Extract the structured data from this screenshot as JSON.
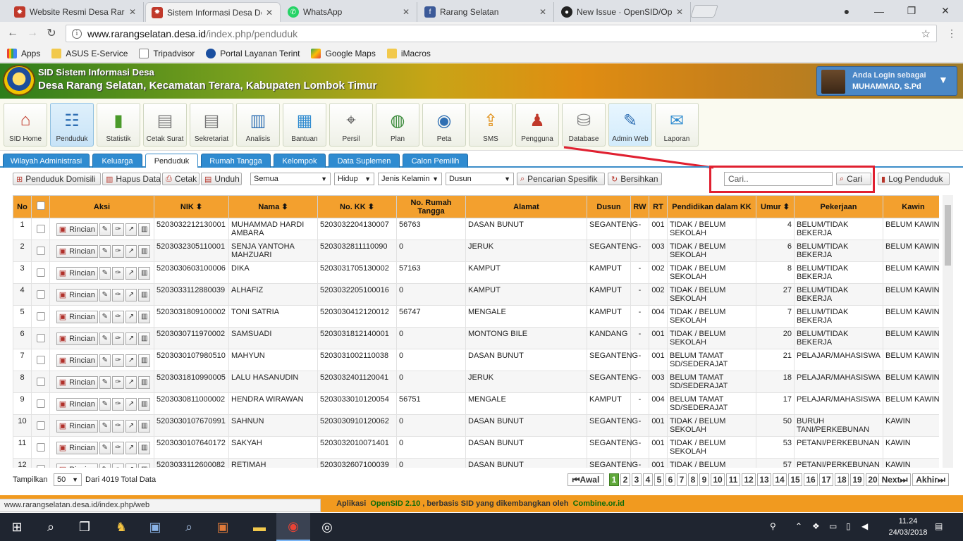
{
  "browser": {
    "tabs": [
      {
        "title": "Website Resmi Desa Rara",
        "favicon": "sid-icon",
        "color": "#c0392b"
      },
      {
        "title": "Sistem Informasi Desa De",
        "favicon": "sid-icon",
        "color": "#c0392b"
      },
      {
        "title": "WhatsApp",
        "favicon": "whatsapp-icon",
        "color": "#25d366"
      },
      {
        "title": "Rarang Selatan",
        "favicon": "facebook-icon",
        "color": "#3b5998"
      },
      {
        "title": "New Issue · OpenSID/Op",
        "favicon": "github-icon",
        "color": "#222222"
      }
    ],
    "url_host": "www.rarangselatan.desa.id",
    "url_path": "/index.php/penduduk",
    "bookmarks": [
      {
        "label": "Apps",
        "color": "#4285f4"
      },
      {
        "label": "ASUS E-Service",
        "color": "#f2c94c"
      },
      {
        "label": "Tripadvisor",
        "color": "#ffffff"
      },
      {
        "label": "Portal Layanan Terint",
        "color": "#1a4fa0"
      },
      {
        "label": "Google Maps",
        "color": "#34a853"
      },
      {
        "label": "iMacros",
        "color": "#f2c94c"
      }
    ]
  },
  "header": {
    "title": "SID Sistem Informasi Desa",
    "subtitle": "Desa Rarang Selatan, Kecamatan Terara, Kabupaten Lombok Timur",
    "login_label": "Anda Login sebagai",
    "login_user": "MUHAMMAD, S.Pd"
  },
  "modules": [
    {
      "label": "SID Home",
      "icon": "home-icon"
    },
    {
      "label": "Penduduk",
      "icon": "people-icon"
    },
    {
      "label": "Statistik",
      "icon": "chart-icon"
    },
    {
      "label": "Cetak Surat",
      "icon": "document-icon"
    },
    {
      "label": "Sekretariat",
      "icon": "document-icon"
    },
    {
      "label": "Analisis",
      "icon": "analysis-icon"
    },
    {
      "label": "Bantuan",
      "icon": "books-icon"
    },
    {
      "label": "Persil",
      "icon": "map-pin-icon"
    },
    {
      "label": "Plan",
      "icon": "globe-search-icon"
    },
    {
      "label": "Peta",
      "icon": "globe-icon"
    },
    {
      "label": "SMS",
      "icon": "sms-icon"
    },
    {
      "label": "Pengguna",
      "icon": "users-icon"
    },
    {
      "label": "Database",
      "icon": "database-icon"
    },
    {
      "label": "Admin Web",
      "icon": "admin-web-icon"
    },
    {
      "label": "Laporan",
      "icon": "mail-icon"
    }
  ],
  "subtabs": [
    "Wilayah Administrasi",
    "Keluarga",
    "Penduduk",
    "Rumah Tangga",
    "Kelompok",
    "Data Suplemen",
    "Calon Pemilih"
  ],
  "toolbar": {
    "domisili": "Penduduk Domisili",
    "hapus": "Hapus Data",
    "cetak": "Cetak",
    "unduh": "Unduh",
    "filter_status": "Semua",
    "filter_hidup": "Hidup",
    "filter_jk": "Jenis Kelamin",
    "filter_dusun": "Dusun",
    "pencarian": "Pencarian Spesifik",
    "bersihkan": "Bersihkan",
    "search_placeholder": "Cari..",
    "cari": "Cari",
    "log": "Log Penduduk"
  },
  "table": {
    "headers": [
      "No",
      "",
      "Aksi",
      "NIK ⬍",
      "Nama ⬍",
      "No. KK ⬍",
      "No. Rumah Tangga",
      "Alamat",
      "Dusun",
      "RW",
      "RT",
      "Pendidikan dalam KK",
      "Umur ⬍",
      "Pekerjaan",
      "Kawin"
    ],
    "rincian": "Rincian",
    "rows": [
      {
        "no": "1",
        "nik": "5203032212130001",
        "nama": "MUHAMMAD HARDI AMBARA",
        "kk": "5203032204130007",
        "rt_no": "56763",
        "alamat": "DASAN BUNUT",
        "dusun": "SEGANTENG",
        "rw": "-",
        "rt": "001",
        "pend": "TIDAK / BELUM SEKOLAH",
        "umur": "4",
        "kerja": "BELUM/TIDAK BEKERJA",
        "kawin": "BELUM KAWIN"
      },
      {
        "no": "2",
        "nik": "5203032305110001",
        "nama": "SENJA YANTOHA MAHZUARI",
        "kk": "5203032811110090",
        "rt_no": "0",
        "alamat": "JERUK",
        "dusun": "SEGANTENG",
        "rw": "-",
        "rt": "003",
        "pend": "TIDAK / BELUM SEKOLAH",
        "umur": "6",
        "kerja": "BELUM/TIDAK BEKERJA",
        "kawin": "BELUM KAWIN"
      },
      {
        "no": "3",
        "nik": "5203030603100006",
        "nama": "DIKA",
        "kk": "5203031705130002",
        "rt_no": "57163",
        "alamat": "KAMPUT",
        "dusun": "KAMPUT",
        "rw": "-",
        "rt": "002",
        "pend": "TIDAK / BELUM SEKOLAH",
        "umur": "8",
        "kerja": "BELUM/TIDAK BEKERJA",
        "kawin": "BELUM KAWIN"
      },
      {
        "no": "4",
        "nik": "5203033112880039",
        "nama": "ALHAFIZ",
        "kk": "5203032205100016",
        "rt_no": "0",
        "alamat": "KAMPUT",
        "dusun": "KAMPUT",
        "rw": "-",
        "rt": "002",
        "pend": "TIDAK / BELUM SEKOLAH",
        "umur": "27",
        "kerja": "BELUM/TIDAK BEKERJA",
        "kawin": "BELUM KAWIN"
      },
      {
        "no": "5",
        "nik": "5203031809100002",
        "nama": "TONI SATRIA",
        "kk": "5203030412120012",
        "rt_no": "56747",
        "alamat": "MENGALE",
        "dusun": "KAMPUT",
        "rw": "-",
        "rt": "004",
        "pend": "TIDAK / BELUM SEKOLAH",
        "umur": "7",
        "kerja": "BELUM/TIDAK BEKERJA",
        "kawin": "BELUM KAWIN"
      },
      {
        "no": "6",
        "nik": "5203030711970002",
        "nama": "SAMSUADI",
        "kk": "5203031812140001",
        "rt_no": "0",
        "alamat": "MONTONG BILE",
        "dusun": "KANDANG",
        "rw": "-",
        "rt": "001",
        "pend": "TIDAK / BELUM SEKOLAH",
        "umur": "20",
        "kerja": "BELUM/TIDAK BEKERJA",
        "kawin": "BELUM KAWIN"
      },
      {
        "no": "7",
        "nik": "5203030107980510",
        "nama": "MAHYUN",
        "kk": "5203031002110038",
        "rt_no": "0",
        "alamat": "DASAN BUNUT",
        "dusun": "SEGANTENG",
        "rw": "-",
        "rt": "001",
        "pend": "BELUM TAMAT SD/SEDERAJAT",
        "umur": "21",
        "kerja": "PELAJAR/MAHASISWA",
        "kawin": "BELUM KAWIN"
      },
      {
        "no": "8",
        "nik": "5203031810990005",
        "nama": "LALU HASANUDIN",
        "kk": "5203032401120041",
        "rt_no": "0",
        "alamat": "JERUK",
        "dusun": "SEGANTENG",
        "rw": "-",
        "rt": "003",
        "pend": "BELUM TAMAT SD/SEDERAJAT",
        "umur": "18",
        "kerja": "PELAJAR/MAHASISWA",
        "kawin": "BELUM KAWIN"
      },
      {
        "no": "9",
        "nik": "5203030811000002",
        "nama": "HENDRA WIRAWAN",
        "kk": "5203033010120054",
        "rt_no": "56751",
        "alamat": "MENGALE",
        "dusun": "KAMPUT",
        "rw": "-",
        "rt": "004",
        "pend": "BELUM TAMAT SD/SEDERAJAT",
        "umur": "17",
        "kerja": "PELAJAR/MAHASISWA",
        "kawin": "BELUM KAWIN"
      },
      {
        "no": "10",
        "nik": "5203030107670991",
        "nama": "SAHNUN",
        "kk": "5203030910120062",
        "rt_no": "0",
        "alamat": "DASAN BUNUT",
        "dusun": "SEGANTENG",
        "rw": "-",
        "rt": "001",
        "pend": "TIDAK / BELUM SEKOLAH",
        "umur": "50",
        "kerja": "BURUH TANI/PERKEBUNAN",
        "kawin": "KAWIN"
      },
      {
        "no": "11",
        "nik": "5203030107640172",
        "nama": "SAKYAH",
        "kk": "5203032010071401",
        "rt_no": "0",
        "alamat": "DASAN BUNUT",
        "dusun": "SEGANTENG",
        "rw": "-",
        "rt": "001",
        "pend": "TIDAK / BELUM SEKOLAH",
        "umur": "53",
        "kerja": "PETANI/PERKEBUNAN",
        "kawin": "KAWIN"
      },
      {
        "no": "12",
        "nik": "5203033112600082",
        "nama": "RETIMAH",
        "kk": "5203032607100039",
        "rt_no": "0",
        "alamat": "DASAN BUNUT",
        "dusun": "SEGANTENG",
        "rw": "-",
        "rt": "001",
        "pend": "TIDAK / BELUM SEKOLAH",
        "umur": "57",
        "kerja": "PETANI/PERKEBUNAN",
        "kawin": "KAWIN"
      }
    ]
  },
  "pagination": {
    "tampilkan": "Tampilkan",
    "per_page": "50",
    "total": "Dari 4019 Total Data",
    "awal": "Awal",
    "next": "Next",
    "akhir": "Akhir",
    "pages": [
      "1",
      "2",
      "3",
      "4",
      "5",
      "6",
      "7",
      "8",
      "9",
      "10",
      "11",
      "12",
      "13",
      "14",
      "15",
      "16",
      "17",
      "18",
      "19",
      "20"
    ]
  },
  "footer": {
    "pre": "Aplikasi",
    "app": "OpenSID 2.10",
    "mid": ", berbasis SID yang dikembangkan oleh",
    "org": "Combine.or.id",
    "status_url": "www.rarangselatan.desa.id/index.php/web"
  },
  "taskbar": {
    "time": "11.24",
    "date": "24/03/2018"
  }
}
